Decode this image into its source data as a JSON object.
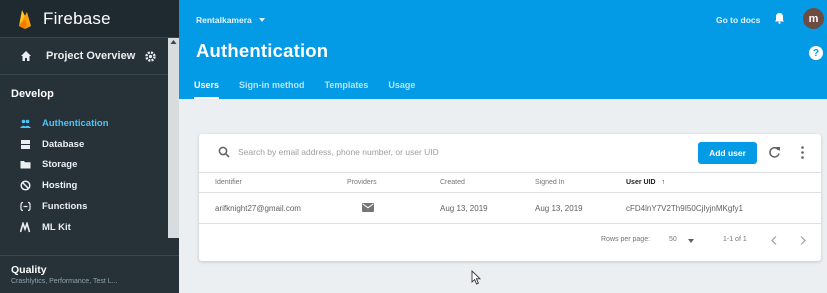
{
  "sidebar": {
    "brand": "Firebase",
    "overview_label": "Project Overview",
    "develop_heading": "Develop",
    "items": [
      {
        "label": "Authentication",
        "icon": "people-icon",
        "active": true
      },
      {
        "label": "Database",
        "icon": "database-icon",
        "active": false
      },
      {
        "label": "Storage",
        "icon": "folder-icon",
        "active": false
      },
      {
        "label": "Hosting",
        "icon": "globe-icon",
        "active": false
      },
      {
        "label": "Functions",
        "icon": "functions-icon",
        "active": false
      },
      {
        "label": "ML Kit",
        "icon": "ml-kit-icon",
        "active": false
      }
    ],
    "quality_heading": "Quality",
    "quality_subtitle": "Crashlytics, Performance, Test L..."
  },
  "header": {
    "project_name": "Rentalkamera",
    "docs_link": "Go to docs",
    "avatar_initial": "m",
    "page_title": "Authentication",
    "help_glyph": "?",
    "tabs": [
      {
        "label": "Users",
        "active": true
      },
      {
        "label": "Sign-in method",
        "active": false
      },
      {
        "label": "Templates",
        "active": false
      },
      {
        "label": "Usage",
        "active": false
      }
    ]
  },
  "users": {
    "search_placeholder": "Search by email address, phone number, or user UID",
    "add_user_label": "Add user",
    "columns": [
      "Identifier",
      "Providers",
      "Created",
      "Signed In",
      "User UID"
    ],
    "sort_indicator": "↑",
    "rows": [
      {
        "identifier": "arifknight27@gmail.com",
        "provider": "email-icon",
        "created": "Aug 13, 2019",
        "signed_in": "Aug 13, 2019",
        "uid": "cFD4lnY7V2Th9I50CjIyjnMKgfy1"
      }
    ],
    "rows_per_page_label": "Rows per page:",
    "rows_per_page_value": "50",
    "page_range": "1-1 of 1"
  },
  "colors": {
    "header_blue": "#039be5",
    "sidebar_dark": "#263238",
    "active_nav": "#4fc3f7",
    "avatar_brown": "#6d4c41"
  }
}
